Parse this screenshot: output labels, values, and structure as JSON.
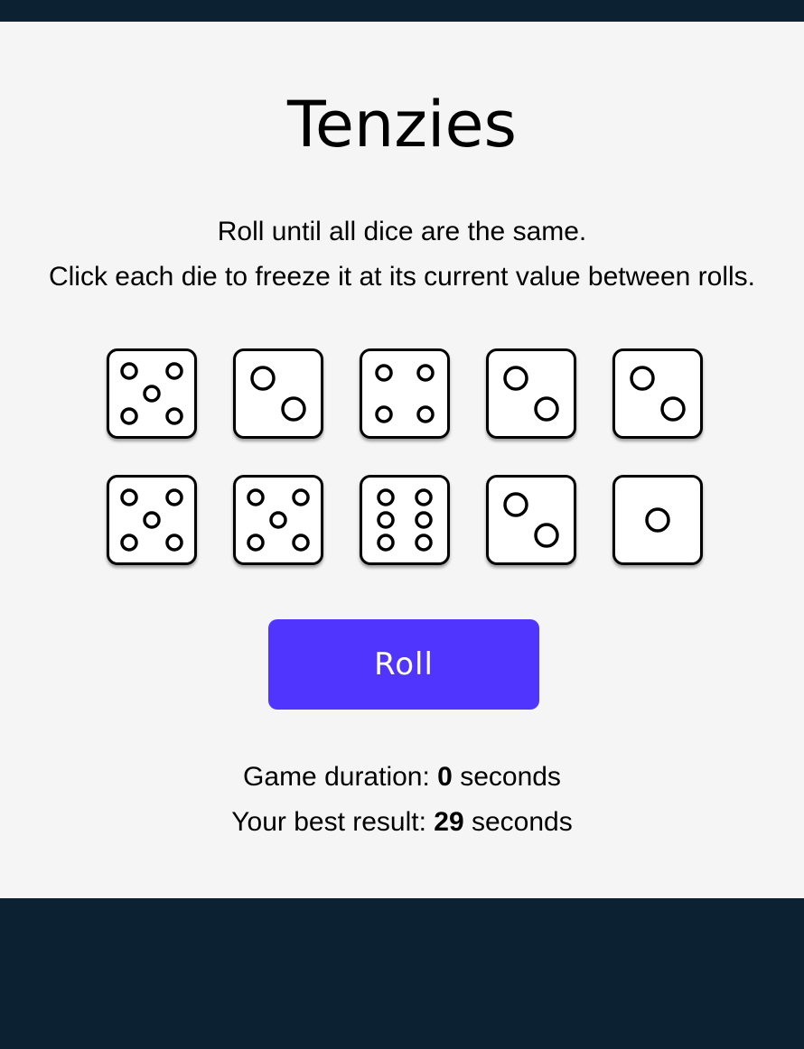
{
  "game": {
    "title": "Tenzies",
    "instructions": [
      "Roll until all dice are the same.",
      "Click each die to freeze it at its current value between rolls."
    ],
    "dice": [
      {
        "value": 5,
        "held": false
      },
      {
        "value": 2,
        "held": false
      },
      {
        "value": 4,
        "held": false
      },
      {
        "value": 2,
        "held": false
      },
      {
        "value": 2,
        "held": false
      },
      {
        "value": 5,
        "held": false
      },
      {
        "value": 5,
        "held": false
      },
      {
        "value": 6,
        "held": false
      },
      {
        "value": 2,
        "held": false
      },
      {
        "value": 1,
        "held": false
      }
    ],
    "roll_button_label": "Roll",
    "duration": {
      "label": "Game duration: ",
      "value": "0",
      "unit": " seconds"
    },
    "best": {
      "label": "Your best result: ",
      "value": "29",
      "unit": " seconds"
    }
  },
  "colors": {
    "background": "#0c2233",
    "card": "#f5f5f5",
    "die_face": "#ffffff",
    "die_held": "#59e391",
    "button": "#5035ff",
    "button_text": "#ffffff"
  }
}
